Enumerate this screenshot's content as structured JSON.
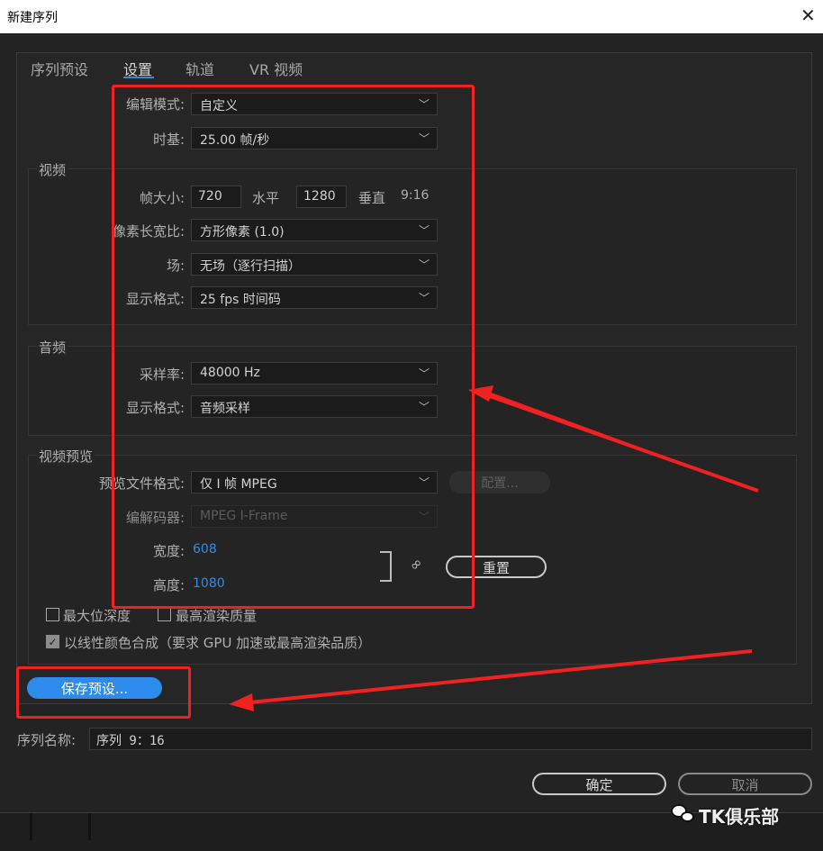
{
  "window": {
    "title": "新建序列",
    "close_glyph": "✕"
  },
  "tabs": [
    {
      "label": "序列预设"
    },
    {
      "label": "设置"
    },
    {
      "label": "轨道"
    },
    {
      "label": "VR 视频"
    }
  ],
  "settings": {
    "edit_mode_label": "编辑模式:",
    "edit_mode_value": "自定义",
    "timebase_label": "时基:",
    "timebase_value": "25.00  帧/秒"
  },
  "video": {
    "title": "视频",
    "frame_size_label": "帧大小:",
    "frame_width": "720",
    "horizontal_label": "水平",
    "frame_height": "1280",
    "vertical_label": "垂直",
    "aspect": "9:16",
    "pixel_aspect_label": "像素长宽比:",
    "pixel_aspect_value": "方形像素 (1.0)",
    "fields_label": "场:",
    "fields_value": "无场（逐行扫描）",
    "display_format_label": "显示格式:",
    "display_format_value": "25 fps 时间码"
  },
  "audio": {
    "title": "音频",
    "sample_rate_label": "采样率:",
    "sample_rate_value": "48000 Hz",
    "display_format_label": "显示格式:",
    "display_format_value": "音频采样"
  },
  "preview": {
    "title": "视频预览",
    "file_format_label": "预览文件格式:",
    "file_format_value": "仅 I 帧 MPEG",
    "configure_label": "配置...",
    "codec_label": "编解码器:",
    "codec_value": "MPEG I-Frame",
    "width_label": "宽度:",
    "width_value": "608",
    "height_label": "高度:",
    "height_value": "1080",
    "link_glyph": "🔗",
    "reset_label": "重置"
  },
  "options": {
    "max_bit_depth_label": "最大位深度",
    "max_bit_depth_checked": false,
    "max_render_quality_label": "最高渲染质量",
    "max_render_quality_checked": false,
    "linear_color_label": "以线性颜色合成（要求 GPU 加速或最高渲染品质）",
    "linear_color_checked": true
  },
  "save_preset_label": "保存预设...",
  "sequence_name_label": "序列名称:",
  "sequence_name_value": "序列 9：16",
  "ok_label": "确定",
  "cancel_label": "取消",
  "watermark": "TK俱乐部",
  "colors": {
    "accent": "#2d8ceb",
    "annotation_red": "#f22121",
    "background": "#232323"
  }
}
